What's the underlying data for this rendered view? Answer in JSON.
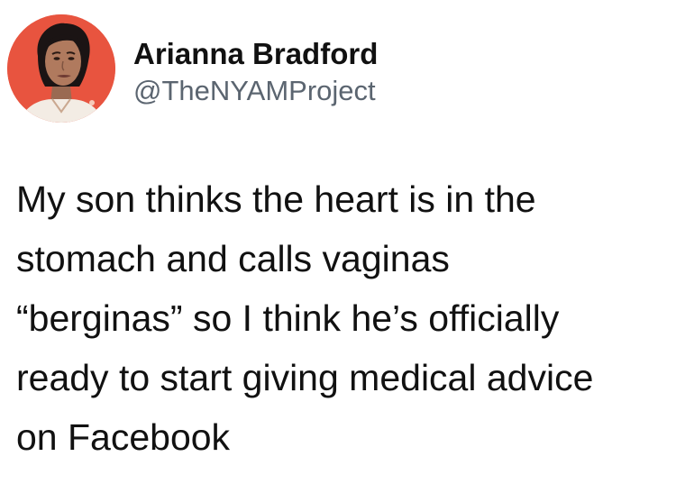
{
  "tweet": {
    "author": {
      "display_name": "Arianna Bradford",
      "handle": "@TheNYAMProject",
      "avatar_icon": "woman-portrait-avatar"
    },
    "text_lines": [
      "My son thinks the heart is in the",
      "stomach and calls vaginas",
      "“berginas” so I think he’s officially",
      "ready to start giving medical advice",
      "on Facebook"
    ]
  },
  "colors": {
    "background": "#ffffff",
    "avatar_background": "#e8543f",
    "text": "#111111",
    "handle": "#5b6570"
  }
}
